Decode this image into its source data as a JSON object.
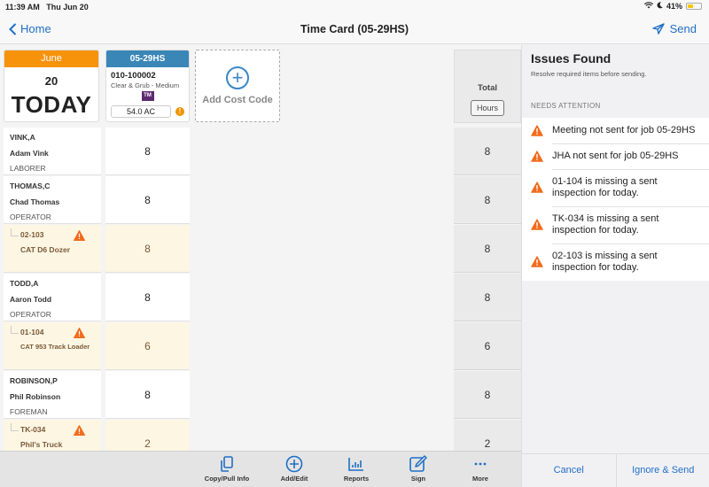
{
  "status_bar": {
    "time": "11:39 AM",
    "date": "Thu Jun 20",
    "battery": "41%",
    "battery_level": 0.41
  },
  "nav": {
    "back_label": "Home",
    "title": "Time Card (05-29HS)",
    "send_label": "Send"
  },
  "date_card": {
    "month": "June",
    "day": "20",
    "label": "TODAY"
  },
  "job_card": {
    "job": "05-29HS",
    "cost_code": "010-100002",
    "description": "Clear & Grub - Medium",
    "tag": "TM",
    "quantity": "54.0 AC",
    "warn": "!"
  },
  "add_cost_code": {
    "icon": "+",
    "label": "Add Cost Code"
  },
  "total": {
    "label": "Total",
    "button": "Hours"
  },
  "rows": [
    {
      "type": "employee",
      "id": "VINK,A",
      "name": "Adam Vink",
      "role": "LABORER",
      "hours": "8",
      "total": "8"
    },
    {
      "type": "employee",
      "id": "THOMAS,C",
      "name": "Chad Thomas",
      "role": "OPERATOR",
      "hours": "8",
      "total": "8"
    },
    {
      "type": "equipment",
      "id": "02-103",
      "name": "CAT D6 Dozer",
      "hours": "8",
      "total": "8",
      "warning": true
    },
    {
      "type": "employee",
      "id": "TODD,A",
      "name": "Aaron Todd",
      "role": "OPERATOR",
      "hours": "8",
      "total": "8"
    },
    {
      "type": "equipment",
      "id": "01-104",
      "name": "CAT 953 Track Loader",
      "hours": "6",
      "total": "6",
      "warning": true
    },
    {
      "type": "employee",
      "id": "ROBINSON,P",
      "name": "Phil Robinson",
      "role": "FOREMAN",
      "hours": "8",
      "total": "8"
    },
    {
      "type": "equipment",
      "id": "TK-034",
      "name": "Phil's Truck",
      "hours": "2",
      "total": "2",
      "warning": true
    }
  ],
  "toolbar": {
    "items": [
      {
        "label": "Copy/Pull Info",
        "icon": "copy-icon"
      },
      {
        "label": "Add/Edit",
        "icon": "plus-circle-icon"
      },
      {
        "label": "Reports",
        "icon": "bar-chart-icon"
      },
      {
        "label": "Sign",
        "icon": "pencil-icon"
      },
      {
        "label": "More",
        "icon": "more-icon"
      }
    ]
  },
  "issues_panel": {
    "title": "Issues Found",
    "subtitle": "Resolve required items before sending.",
    "section": "NEEDS ATTENTION",
    "issues": [
      "Meeting not sent for job 05-29HS",
      "JHA not sent for job 05-29HS",
      "01-104 is missing a sent inspection for today.",
      "TK-034 is missing a sent inspection for today.",
      "02-103 is missing a sent inspection for today."
    ],
    "cancel_label": "Cancel",
    "ignore_send_label": "Ignore & Send"
  },
  "colors": {
    "accent": "#1f6fc6",
    "date_header": "#f7920b",
    "job_header": "#3a86b7",
    "warning": "#f26b1d",
    "equipment_bg": "#fdf6e3",
    "tm_badge": "#5d2a70"
  }
}
